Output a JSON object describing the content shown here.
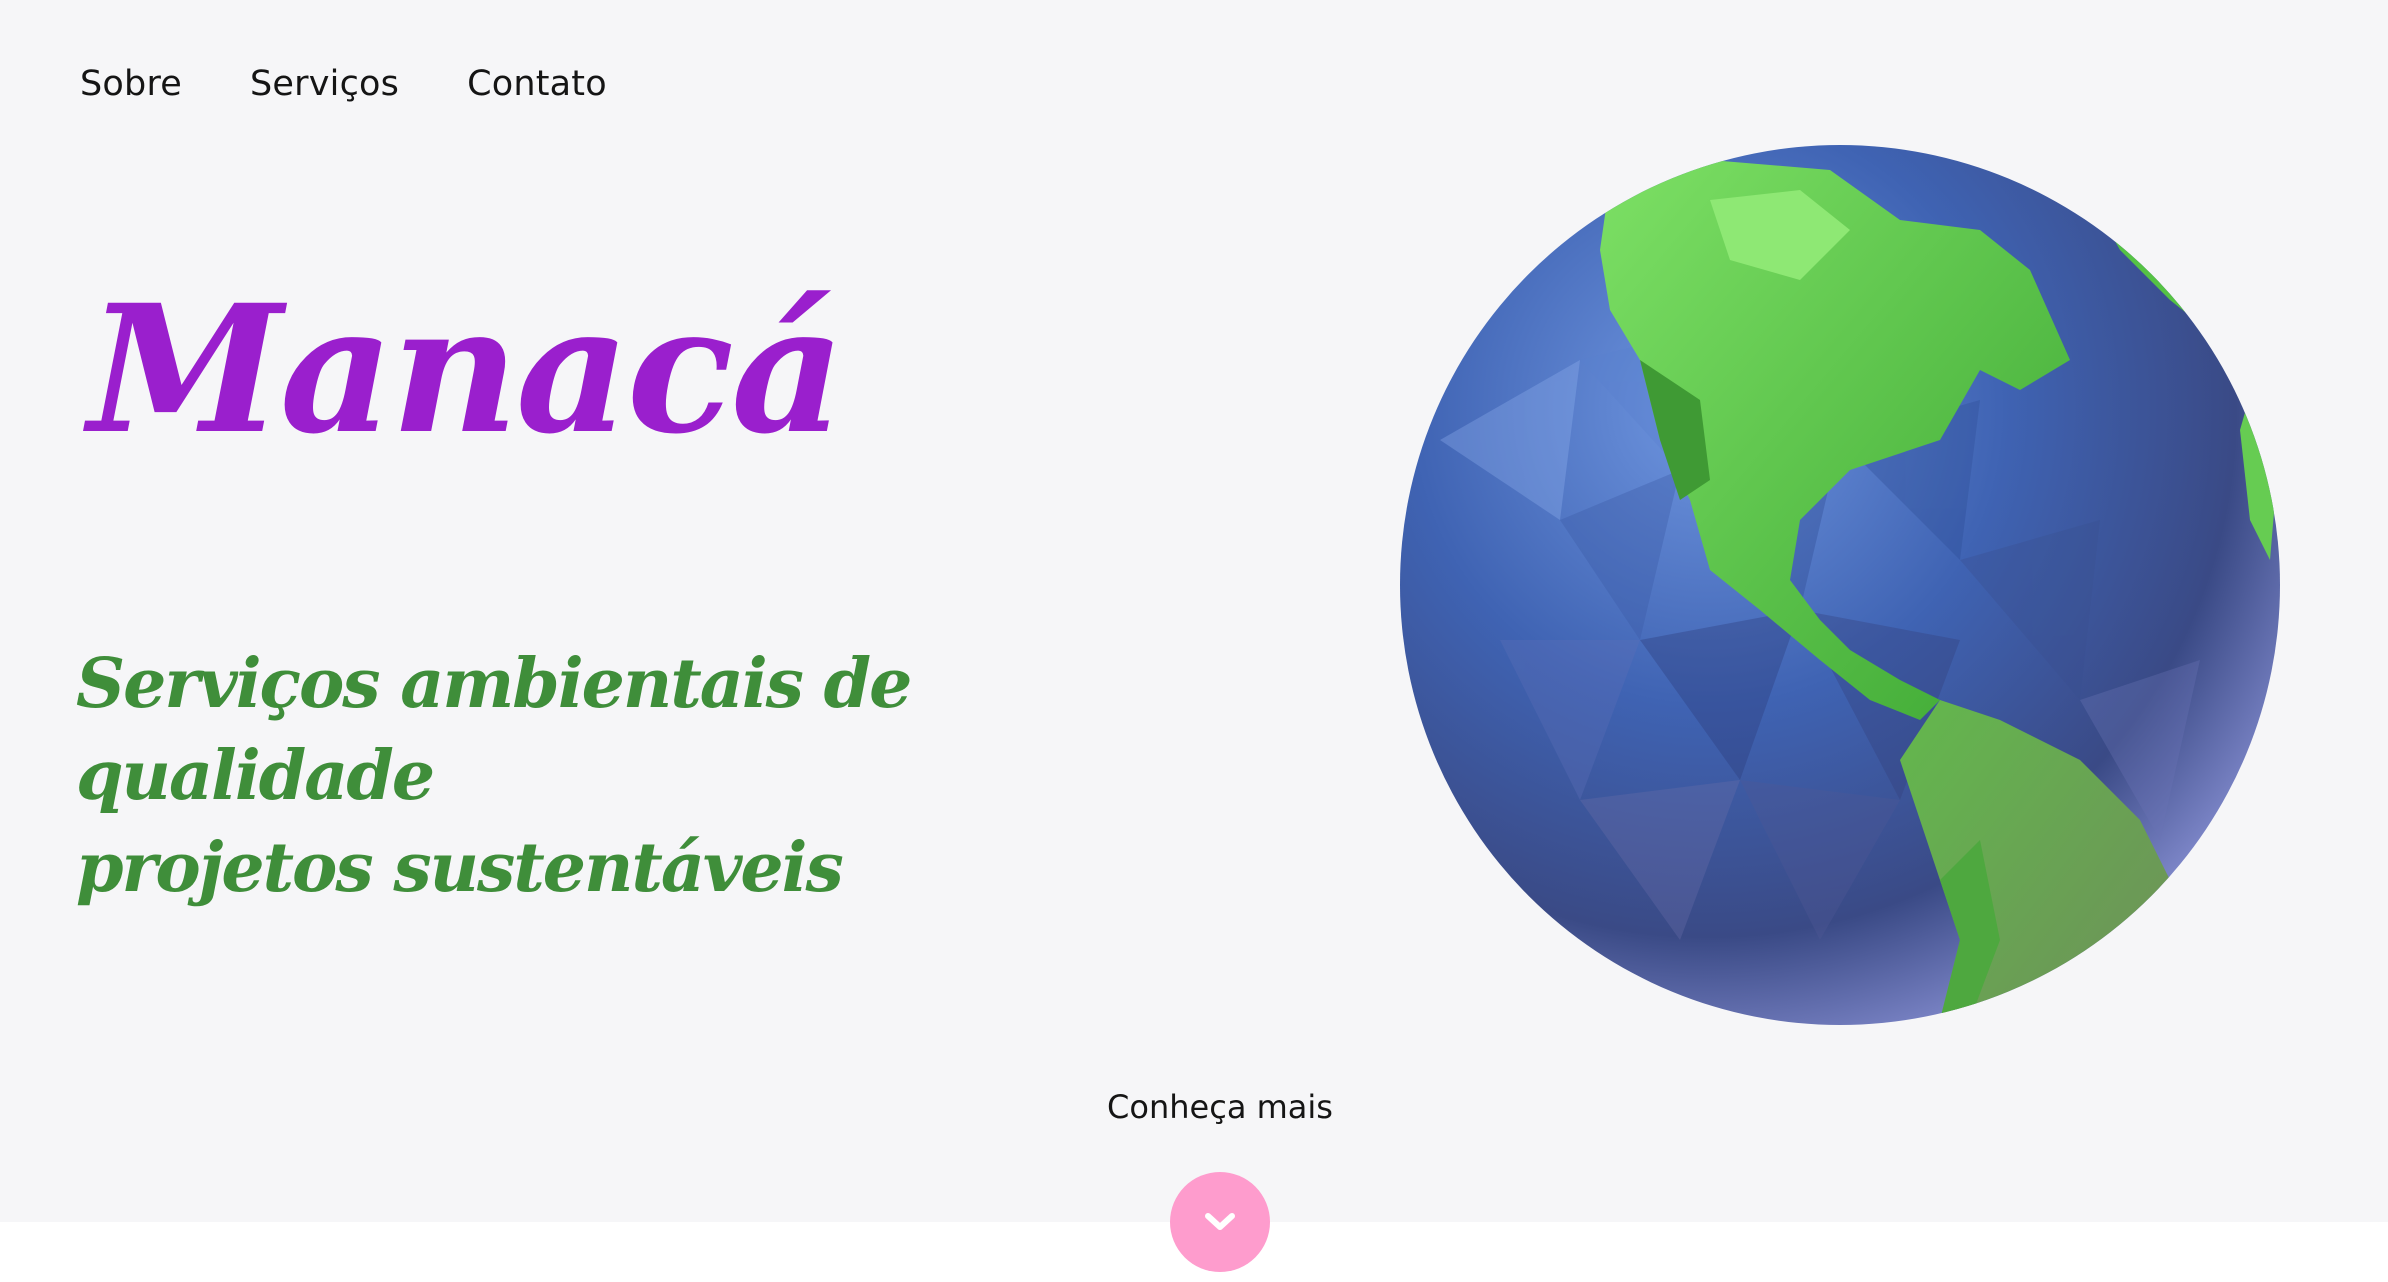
{
  "nav": {
    "items": [
      {
        "label": "Sobre"
      },
      {
        "label": "Serviços"
      },
      {
        "label": "Contato"
      }
    ]
  },
  "hero": {
    "brand": "Manacá",
    "tagline_line1": "Serviços ambientais de qualidade",
    "tagline_line2": "projetos sustentáveis",
    "image_icon": "low-poly-earth-globe-icon"
  },
  "cta": {
    "label": "Conheça mais",
    "icon": "chevron-down-icon"
  },
  "colors": {
    "background": "#f6f6f8",
    "brand": "#9a1fcd",
    "tagline": "#3f8e3a",
    "cta_button": "#fe9ccd",
    "ocean": "#4a6fc0",
    "land": "#5fc24a"
  }
}
